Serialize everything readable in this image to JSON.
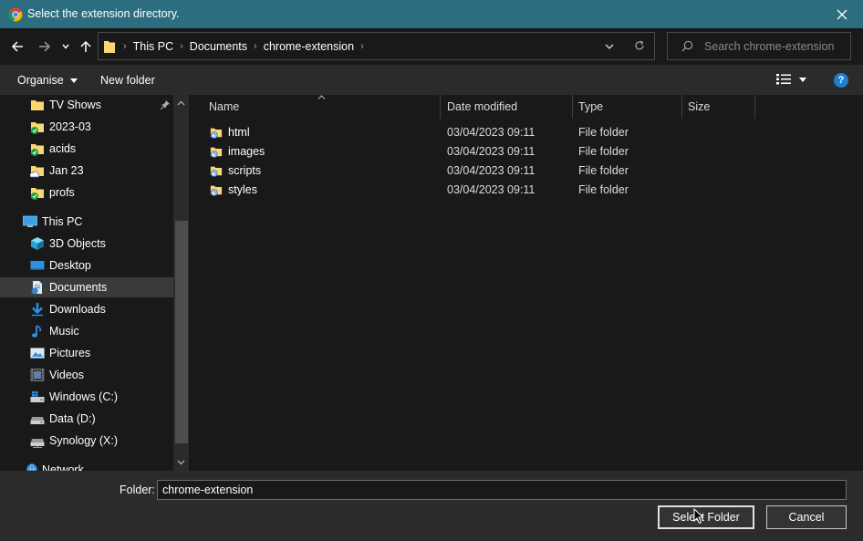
{
  "window": {
    "title": "Select the extension directory.",
    "app_icon": "chrome-icon",
    "close_icon": "close-icon"
  },
  "navigation": {
    "back_icon": "arrow-left-icon",
    "forward_icon": "arrow-right-icon",
    "recent_icon": "chevron-down-icon",
    "up_icon": "arrow-up-icon",
    "breadcrumbs": [
      "This PC",
      "Documents",
      "chrome-extension"
    ],
    "refresh_icon": "refresh-icon",
    "search_placeholder": "Search chrome-extension"
  },
  "toolbar": {
    "organise_label": "Organise",
    "new_folder_label": "New folder",
    "view_icon": "view-details-icon",
    "help_icon": "help-icon",
    "help_text": "?"
  },
  "sidebar": {
    "items": [
      {
        "label": "TV Shows",
        "icon": "folder-icon",
        "pinned": true
      },
      {
        "label": "2023-03",
        "icon": "folder-synced-icon"
      },
      {
        "label": "acids",
        "icon": "folder-synced-icon"
      },
      {
        "label": "Jan 23",
        "icon": "folder-cloud-icon"
      },
      {
        "label": "profs",
        "icon": "folder-synced-icon"
      },
      {
        "label": "This PC",
        "icon": "computer-icon"
      },
      {
        "label": "3D Objects",
        "icon": "3d-objects-icon"
      },
      {
        "label": "Desktop",
        "icon": "desktop-icon"
      },
      {
        "label": "Documents",
        "icon": "documents-icon",
        "selected": true
      },
      {
        "label": "Downloads",
        "icon": "download-icon"
      },
      {
        "label": "Music",
        "icon": "music-icon"
      },
      {
        "label": "Pictures",
        "icon": "pictures-icon"
      },
      {
        "label": "Videos",
        "icon": "videos-icon"
      },
      {
        "label": "Windows (C:)",
        "icon": "drive-windows-icon"
      },
      {
        "label": "Data (D:)",
        "icon": "drive-icon"
      },
      {
        "label": "Synology (X:)",
        "icon": "network-drive-icon"
      },
      {
        "label": "Network",
        "icon": "network-icon"
      }
    ]
  },
  "columns": [
    "Name",
    "Date modified",
    "Type",
    "Size"
  ],
  "files": [
    {
      "name": "html",
      "modified": "03/04/2023 09:11",
      "type": "File folder"
    },
    {
      "name": "images",
      "modified": "03/04/2023 09:11",
      "type": "File folder"
    },
    {
      "name": "scripts",
      "modified": "03/04/2023 09:11",
      "type": "File folder"
    },
    {
      "name": "styles",
      "modified": "03/04/2023 09:11",
      "type": "File folder"
    }
  ],
  "footer": {
    "folder_label": "Folder:",
    "folder_value": "chrome-extension",
    "select_button": "Select Folder",
    "cancel_button": "Cancel"
  },
  "colors": {
    "titlebar": "#2c6e7f",
    "background": "#191919",
    "toolbar": "#2b2b2b",
    "help": "#1b7fd6"
  }
}
